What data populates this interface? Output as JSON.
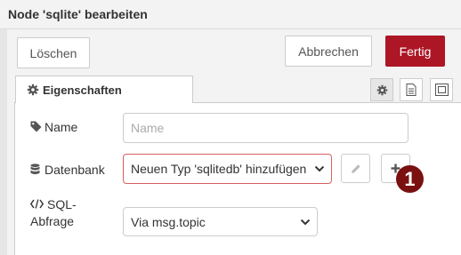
{
  "dialog": {
    "title": "Node 'sqlite' bearbeiten"
  },
  "toolbar": {
    "delete_label": "Löschen",
    "cancel_label": "Abbrechen",
    "done_label": "Fertig"
  },
  "tabs": [
    {
      "label": "Eigenschaften",
      "icon": "gear-icon"
    }
  ],
  "form": {
    "name": {
      "label": "Name",
      "placeholder": "Name",
      "icon": "tag-icon"
    },
    "database": {
      "label": "Datenbank",
      "value": "Neuen Typ 'sqlitedb' hinzufügen",
      "icon": "database-icon"
    },
    "query": {
      "label_line1": "SQL-",
      "label_line2": "Abfrage",
      "value": "Via msg.topic",
      "icon": "code-icon"
    }
  },
  "annotation": {
    "badge": "1"
  },
  "colors": {
    "primary": "#ad1625",
    "badge": "#7a1010",
    "error_border": "#d6615f"
  }
}
